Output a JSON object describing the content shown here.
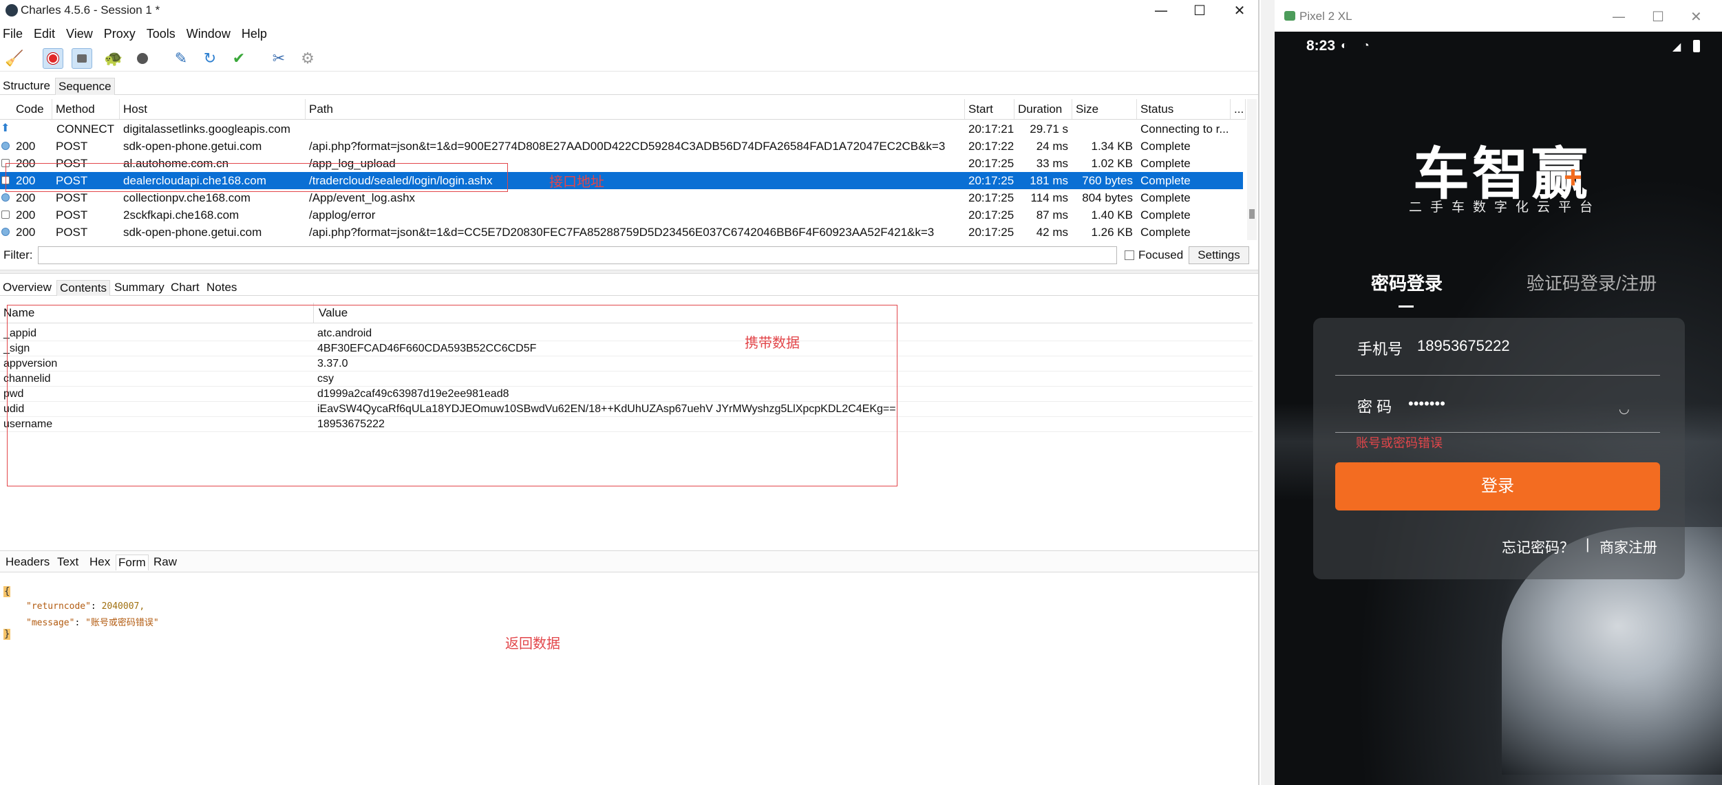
{
  "charles": {
    "title": "Charles 4.5.6 - Session 1 *",
    "window_controls": [
      "—",
      "☐",
      "✕"
    ],
    "menu": [
      "File",
      "Edit",
      "View",
      "Proxy",
      "Tools",
      "Window",
      "Help"
    ],
    "view_tabs": [
      "Structure",
      "Sequence"
    ],
    "columns": [
      "Code",
      "Method",
      "Host",
      "Path",
      "Start",
      "Duration",
      "Size",
      "Status",
      "..."
    ],
    "rows": [
      {
        "code": "",
        "method": "CONNECT",
        "host": "digitalassetlinks.googleapis.com",
        "path": "",
        "start": "20:17:21",
        "duration": "29.71 s",
        "size": "",
        "status": "Connecting to r..."
      },
      {
        "code": "200",
        "method": "POST",
        "host": "sdk-open-phone.getui.com",
        "path": "/api.php?format=json&t=1&d=900E2774D808E27AAD00D422CD59284C3ADB56D74DFA26584FAD1A72047EC2CB&k=3",
        "start": "20:17:22",
        "duration": "24 ms",
        "size": "1.34 KB",
        "status": "Complete"
      },
      {
        "code": "200",
        "method": "POST",
        "host": "al.autohome.com.cn",
        "path": "/app_log_upload",
        "start": "20:17:25",
        "duration": "33 ms",
        "size": "1.02 KB",
        "status": "Complete"
      },
      {
        "code": "200",
        "method": "POST",
        "host": "dealercloudapi.che168.com",
        "path": "/tradercloud/sealed/login/login.ashx",
        "start": "20:17:25",
        "duration": "181 ms",
        "size": "760 bytes",
        "status": "Complete"
      },
      {
        "code": "200",
        "method": "POST",
        "host": "collectionpv.che168.com",
        "path": "/App/event_log.ashx",
        "start": "20:17:25",
        "duration": "114 ms",
        "size": "804 bytes",
        "status": "Complete"
      },
      {
        "code": "200",
        "method": "POST",
        "host": "2sckfkapi.che168.com",
        "path": "/applog/error",
        "start": "20:17:25",
        "duration": "87 ms",
        "size": "1.40 KB",
        "status": "Complete"
      },
      {
        "code": "200",
        "method": "POST",
        "host": "sdk-open-phone.getui.com",
        "path": "/api.php?format=json&t=1&d=CC5E7D20830FEC7FA85288759D5D23456E037C6742046BB6F4F60923AA52F421&k=3",
        "start": "20:17:25",
        "duration": "42 ms",
        "size": "1.26 KB",
        "status": "Complete"
      }
    ],
    "filter_label": "Filter:",
    "focused_label": "Focused",
    "settings_label": "Settings",
    "detail_tabs": [
      "Overview",
      "Contents",
      "Summary",
      "Chart",
      "Notes"
    ],
    "form_columns": [
      "Name",
      "Value"
    ],
    "form_rows": [
      {
        "name": "_appid",
        "value": "atc.android"
      },
      {
        "name": "_sign",
        "value": "4BF30EFCAD46F660CDA593B52CC6CD5F"
      },
      {
        "name": "appversion",
        "value": "3.37.0"
      },
      {
        "name": "channelid",
        "value": "csy"
      },
      {
        "name": "pwd",
        "value": "d1999a2caf49c63987d19e2ee981ead8"
      },
      {
        "name": "udid",
        "value": "iEavSW4QycaRf6qULa18YDJEOmuw10SBwdVu62EN/18++KdUhUZAsp67uehV JYrMWyshzg5LlXpcpKDL2C4EKg=="
      },
      {
        "name": "username",
        "value": "18953675222"
      }
    ],
    "response_tabs": [
      "Headers",
      "Text",
      "Hex",
      "Form",
      "Raw"
    ],
    "json": {
      "open": "{",
      "line1_key": "\"returncode\"",
      "line1_val": "2040007,",
      "line2_key": "\"message\"",
      "line2_val": "\"账号或密码错误\"",
      "close": "}"
    },
    "annotations": {
      "url": "接口地址",
      "params": "携带数据",
      "response": "返回数据"
    }
  },
  "emulator": {
    "title": "Pixel 2 XL",
    "time": "8:23",
    "logo": "车智赢",
    "logo_plus": "+",
    "tagline": "二手车数字化云平台",
    "tab_password": "密码登录",
    "tab_sms": "验证码登录/注册",
    "phone_label": "手机号",
    "phone_value": "18953675222",
    "pwd_label": "密 码",
    "pwd_value": "•••••••",
    "error": "账号或密码错误",
    "login_button": "登录",
    "forgot": "忘记密码？",
    "separator": "|",
    "register": "商家注册"
  },
  "colors": {
    "selection": "#0a6fd4",
    "annotation": "#e2464a",
    "login_button": "#f36c21"
  }
}
